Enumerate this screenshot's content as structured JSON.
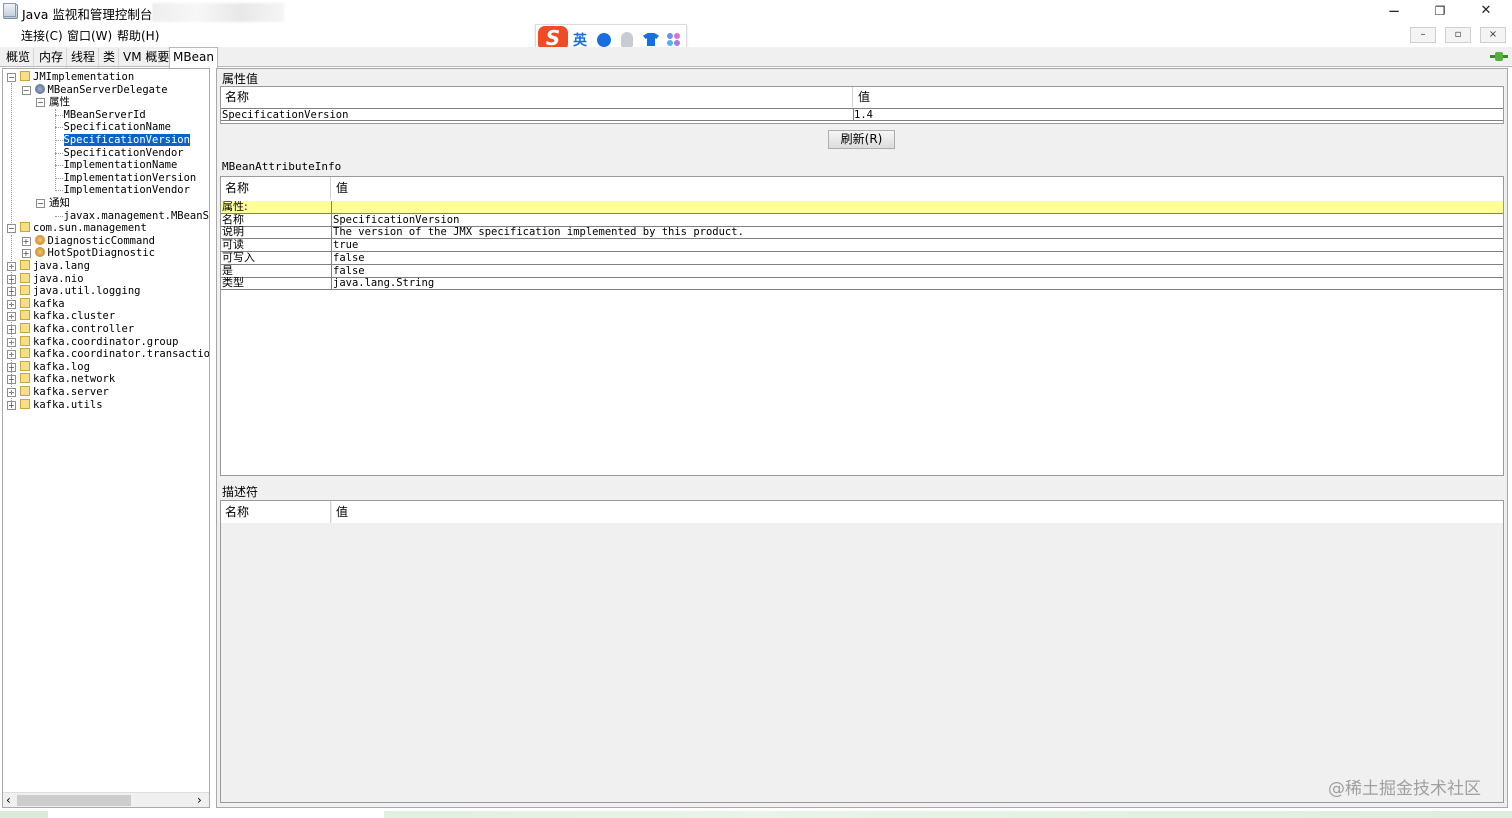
{
  "window": {
    "title": "Java 监视和管理控制台",
    "controls": {
      "minimize": "−",
      "maximize": "❐",
      "close": "✕"
    }
  },
  "menubar": {
    "items": [
      "连接(C)",
      "窗口(W)",
      "帮助(H)"
    ],
    "mdi_controls": {
      "minimize": "–",
      "restore": "▫",
      "close": "×"
    }
  },
  "ime": {
    "logo": "S",
    "lang": "英"
  },
  "tabs": [
    "概览",
    "内存",
    "线程",
    "类",
    "VM 概要",
    "MBean"
  ],
  "tree": {
    "nodes": [
      {
        "label": "JMImplementation",
        "type": "folder",
        "expanded": true
      },
      {
        "label": "MBeanServerDelegate",
        "type": "bean-blue",
        "expanded": true
      },
      {
        "label": "属性",
        "type": "group",
        "expanded": true
      },
      {
        "label": "MBeanServerId",
        "type": "leaf"
      },
      {
        "label": "SpecificationName",
        "type": "leaf"
      },
      {
        "label": "SpecificationVersion",
        "type": "leaf",
        "selected": true
      },
      {
        "label": "SpecificationVendor",
        "type": "leaf"
      },
      {
        "label": "ImplementationName",
        "type": "leaf"
      },
      {
        "label": "ImplementationVersion",
        "type": "leaf"
      },
      {
        "label": "ImplementationVendor",
        "type": "leaf"
      },
      {
        "label": "通知",
        "type": "group",
        "expanded": true
      },
      {
        "label": "javax.management.MBeanS(",
        "type": "leaf"
      },
      {
        "label": "com.sun.management",
        "type": "folder",
        "expanded": true
      },
      {
        "label": "DiagnosticCommand",
        "type": "bean",
        "expanded": false
      },
      {
        "label": "HotSpotDiagnostic",
        "type": "bean",
        "expanded": false
      },
      {
        "label": "java.lang",
        "type": "folder",
        "expanded": false
      },
      {
        "label": "java.nio",
        "type": "folder",
        "expanded": false
      },
      {
        "label": "java.util.logging",
        "type": "folder",
        "expanded": false
      },
      {
        "label": "kafka",
        "type": "folder",
        "expanded": false
      },
      {
        "label": "kafka.cluster",
        "type": "folder",
        "expanded": false
      },
      {
        "label": "kafka.controller",
        "type": "folder",
        "expanded": false
      },
      {
        "label": "kafka.coordinator.group",
        "type": "folder",
        "expanded": false
      },
      {
        "label": "kafka.coordinator.transactio",
        "type": "folder",
        "expanded": false
      },
      {
        "label": "kafka.log",
        "type": "folder",
        "expanded": false
      },
      {
        "label": "kafka.network",
        "type": "folder",
        "expanded": false
      },
      {
        "label": "kafka.server",
        "type": "folder",
        "expanded": false
      },
      {
        "label": "kafka.utils",
        "type": "folder",
        "expanded": false
      }
    ],
    "scroll": {
      "left": "‹",
      "right": "›"
    }
  },
  "attribute_value": {
    "section_title": "属性值",
    "header_name": "名称",
    "header_value": "值",
    "row_name": "SpecificationVersion",
    "row_value": "1.4",
    "refresh_label": "刷新(R)"
  },
  "attribute_info": {
    "section_title": "MBeanAttributeInfo",
    "header_name": "名称",
    "header_value": "值",
    "rows": [
      {
        "name": "属性:",
        "value": ""
      },
      {
        "name": "名称",
        "value": "SpecificationVersion"
      },
      {
        "name": "说明",
        "value": "The version of the JMX specification implemented by this product."
      },
      {
        "name": "可读",
        "value": "true"
      },
      {
        "name": "可写入",
        "value": "false"
      },
      {
        "name": "是",
        "value": "false"
      },
      {
        "name": "类型",
        "value": "java.lang.String"
      }
    ],
    "highlight_color": "#ffff99"
  },
  "descriptor": {
    "section_title": "描述符",
    "header_name": "名称",
    "header_value": "值"
  },
  "watermark": "@稀土掘金技术社区",
  "colors": {
    "selection": "#0a64c8",
    "highlight": "#ffff99",
    "ime_red": "#ef4b24"
  }
}
